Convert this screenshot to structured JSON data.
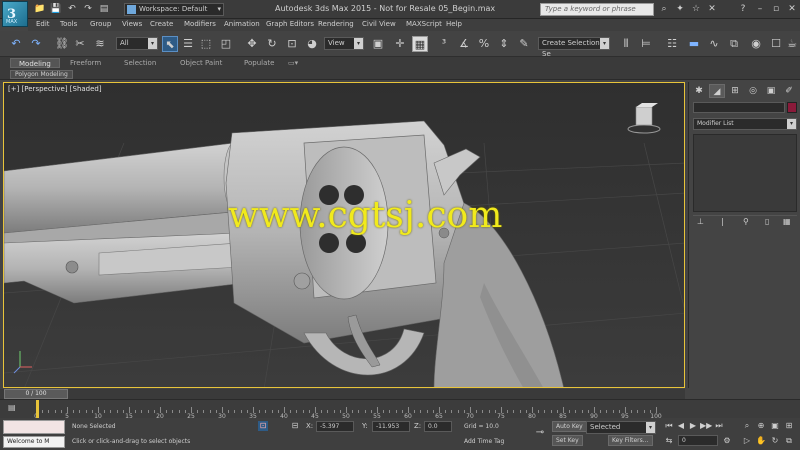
{
  "app": {
    "logo": "3",
    "logo_sub": "MAX",
    "title": "Autodesk 3ds Max 2015 - Not for Resale   05_Begin.max",
    "workspace": "Workspace: Default",
    "search_placeholder": "Type a keyword or phrase"
  },
  "menu": [
    "Edit",
    "Tools",
    "Group",
    "Views",
    "Create",
    "Modifiers",
    "Animation",
    "Graph Editors",
    "Rendering",
    "Civil View",
    "MAXScript",
    "Help"
  ],
  "toolbar": {
    "selection_filter": "All",
    "ref_coord": "View",
    "selection_set": "Create Selection Se"
  },
  "ribbon": {
    "tabs": [
      "Modeling",
      "Freeform",
      "Selection",
      "Object Paint",
      "Populate"
    ],
    "active": "Modeling",
    "subtab": "Polygon Modeling"
  },
  "viewport": {
    "label": "[+] [Perspective] [Shaded]",
    "watermark": "www.cgtsj.com"
  },
  "command_panel": {
    "modifier_list": "Modifier List"
  },
  "timeline": {
    "frame_display": "0 / 100",
    "ticks": [
      0,
      5,
      10,
      15,
      20,
      25,
      30,
      35,
      40,
      45,
      50,
      55,
      60,
      65,
      70,
      75,
      80,
      85,
      90,
      95,
      100
    ],
    "min": 0,
    "max": 100,
    "current_frame": 0
  },
  "status": {
    "welcome": "Welcome to M",
    "selection": "None Selected",
    "prompt": "Click or click-and-drag to select objects",
    "x_label": "X:",
    "x_value": "-5.397",
    "y_label": "Y:",
    "y_value": "-11.953",
    "z_label": "Z:",
    "z_value": "0.0",
    "grid": "Grid = 10.0",
    "auto_key": "Auto Key",
    "selected": "Selected",
    "set_key": "Set Key",
    "key_filters": "Key Filters...",
    "add_time_tag": "Add Time Tag",
    "frame": "0"
  }
}
